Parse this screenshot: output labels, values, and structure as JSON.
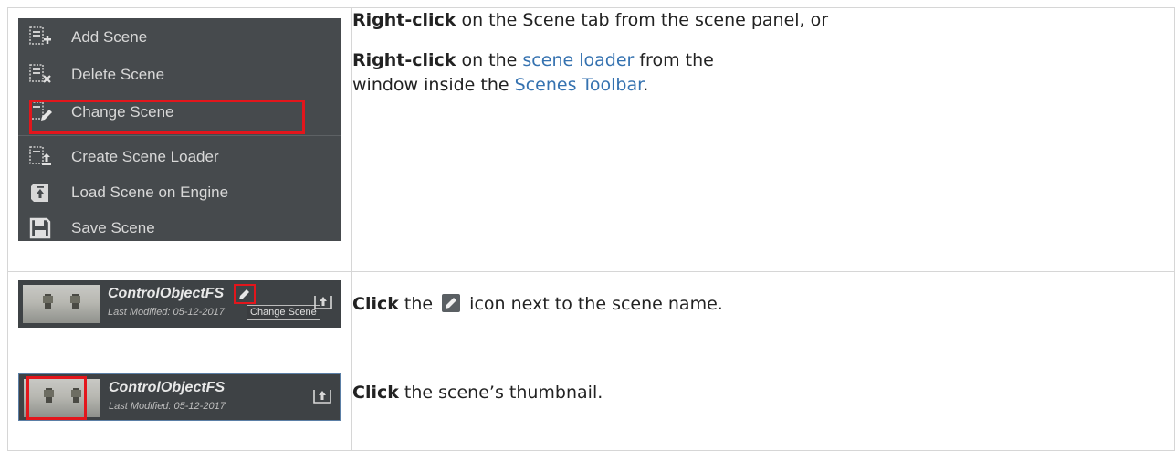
{
  "menu": {
    "items": [
      {
        "label": "Add Scene",
        "icon": "add-scene-icon"
      },
      {
        "label": "Delete Scene",
        "icon": "delete-scene-icon"
      },
      {
        "label": "Change Scene",
        "icon": "change-scene-icon"
      },
      {
        "label": "Create Scene Loader",
        "icon": "create-scene-loader-icon"
      },
      {
        "label": "Load Scene on Engine",
        "icon": "load-scene-icon"
      },
      {
        "label": "Save Scene",
        "icon": "save-icon"
      }
    ]
  },
  "rows": [
    {
      "p1": {
        "bold": "Right-click",
        "rest": " on the Scene tab from the scene panel, or"
      },
      "p2": {
        "bold": "Right-click",
        "mid1": " on the ",
        "link1": "scene loader",
        "mid2": " from the",
        "line2": "window inside the ",
        "link2": "Scenes Toolbar",
        "end": "."
      }
    },
    {
      "scene_name": "ControlObjectFS",
      "modified": "Last Modified: 05-12-2017",
      "tooltip": "Change Scene",
      "bold": "Click",
      "pre": " the ",
      "post": " icon next to the scene name."
    },
    {
      "scene_name": "ControlObjectFS",
      "modified": "Last Modified: 05-12-2017",
      "bold": "Click",
      "post": " the scene’s thumbnail."
    }
  ],
  "colors": {
    "highlight": "#e3161c",
    "link": "#3572b0",
    "menu_bg": "#464a4d"
  }
}
